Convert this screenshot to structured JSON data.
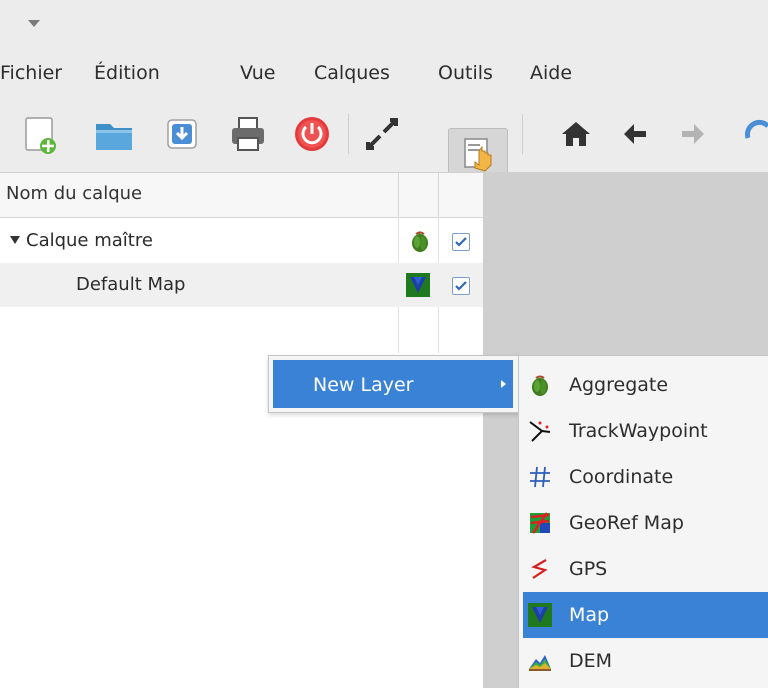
{
  "menubar": {
    "items": [
      "Fichier",
      "Édition",
      "Vue",
      "Calques",
      "Outils",
      "Aide"
    ]
  },
  "toolbar": {
    "buttons": [
      "new-icon",
      "open-folder-icon",
      "save-icon",
      "print-icon",
      "power-icon",
      "fullscreen-icon",
      "pan-tool-icon",
      "home-icon",
      "back-icon",
      "forward-icon",
      "refresh-icon"
    ]
  },
  "layers": {
    "header": "Nom du calque",
    "rows": [
      {
        "label": "Calque maître",
        "icon": "aggregate-icon",
        "checked": true,
        "expanded": true
      },
      {
        "label": "Default Map",
        "icon": "map-icon",
        "checked": true
      }
    ]
  },
  "context_menu": {
    "item": "New Layer"
  },
  "submenu": {
    "items": [
      {
        "label": "Aggregate",
        "icon": "aggregate-icon"
      },
      {
        "label": "TrackWaypoint",
        "icon": "trackwaypoint-icon"
      },
      {
        "label": "Coordinate",
        "icon": "coordinate-icon"
      },
      {
        "label": "GeoRef Map",
        "icon": "georef-map-icon"
      },
      {
        "label": "GPS",
        "icon": "gps-icon"
      },
      {
        "label": "Map",
        "icon": "map-icon",
        "selected": true
      },
      {
        "label": "DEM",
        "icon": "dem-icon"
      }
    ]
  },
  "colors": {
    "selection": "#3a82d6",
    "panel_bg": "#ffffff",
    "canvas_bg": "#cfcfcf"
  }
}
